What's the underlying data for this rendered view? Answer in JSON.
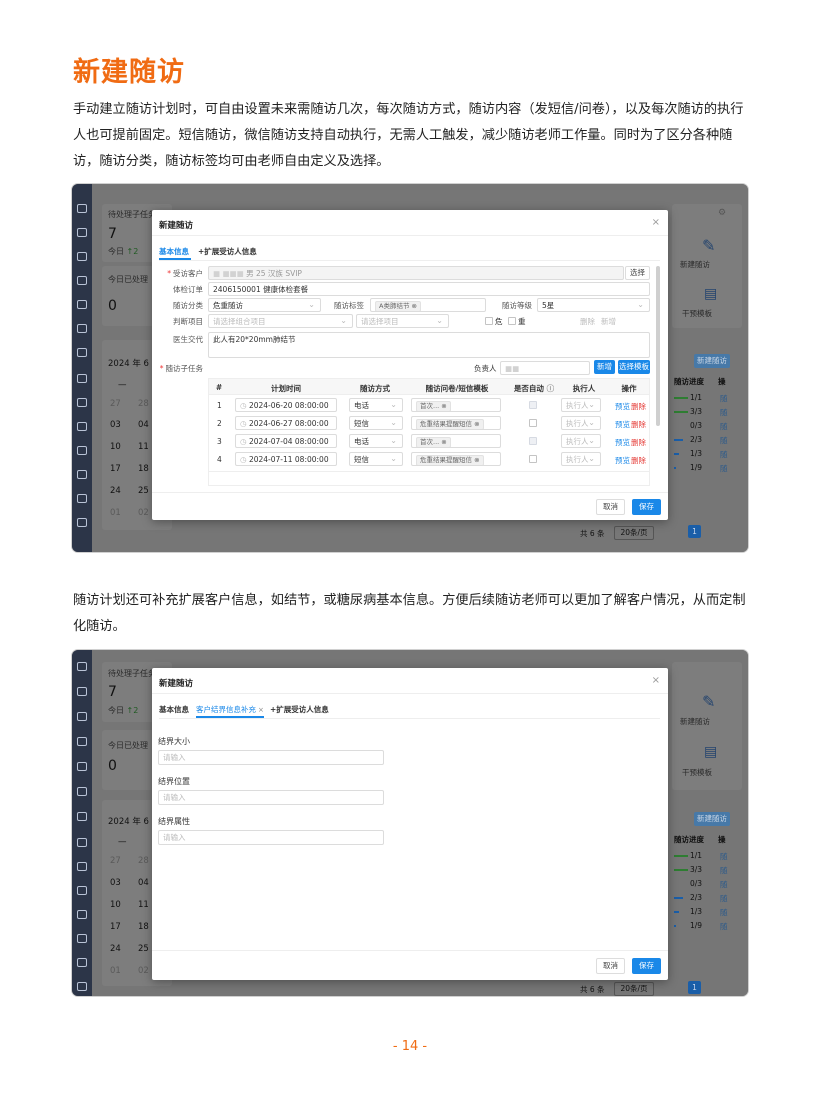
{
  "doc": {
    "heading": "新建随访",
    "para1": "手动建立随访计划时，可自由设置未来需随访几次，每次随访方式，随访内容（发短信/问卷），以及每次随访的执行人也可提前固定。短信随访，微信随访支持自动执行，无需人工触发，减少随访老师工作量。同时为了区分各种随访，随访分类，随访标签均可由老师自由定义及选择。",
    "para2": "随访计划还可补充扩展客户信息，如结节，或糖尿病基本信息。方便后续随访老师可以更加了解客户情况，从而定制化随访。",
    "page_number": "- 14 -"
  },
  "background": {
    "pending_label": "待处理子任务",
    "pending_count": "7",
    "today_label": "今日",
    "today_delta": "↑2",
    "processed_label": "今日已处理",
    "processed_count": "0",
    "calendar_title": "2024 年 6 月",
    "calendar_header": "—",
    "cal_rows": [
      [
        "27",
        "28"
      ],
      [
        "03",
        "04"
      ],
      [
        "10",
        "11"
      ],
      [
        "17",
        "18"
      ],
      [
        "24",
        "25"
      ],
      [
        "01",
        "02"
      ]
    ],
    "new_followup": "新建随访",
    "intervention": "干预模板",
    "new_btn": "新建随访",
    "col_progress": "随访进度",
    "col_op": "操",
    "progress_rows": [
      {
        "label": "1/1",
        "fill": 1.0,
        "color": "#2e7d32"
      },
      {
        "label": "3/3",
        "fill": 1.0,
        "color": "#2e7d32"
      },
      {
        "label": "0/3",
        "fill": 0.0,
        "color": "#2e7d32"
      },
      {
        "label": "2/3",
        "fill": 0.67,
        "color": "#1a5ea8"
      },
      {
        "label": "1/3",
        "fill": 0.33,
        "color": "#1a5ea8"
      },
      {
        "label": "1/9",
        "fill": 0.11,
        "color": "#1a5ea8"
      }
    ],
    "row_link": "随",
    "total": "共 6 条",
    "page_size": "20条/页",
    "page": "1"
  },
  "modal1": {
    "title": "新建随访",
    "tab_basic": "基本信息",
    "tab_extend": "+扩展受访人信息",
    "customer_label": "受访客户",
    "customer_value": "男 25 汉族 SVIP",
    "select_btn": "选择",
    "order_label": "体检订单",
    "order_value": "2406150001 健康体检套餐",
    "category_label": "随访分类",
    "category_value": "危重随访",
    "tag_label": "随访标签",
    "tag_value": "A类肺结节",
    "level_label": "随访等级",
    "level_value": "5星",
    "judge_label": "判断项目",
    "judge_ph1": "请选择组合项目",
    "judge_ph2": "请选择项目",
    "chk_danger": "危",
    "chk_severe": "重",
    "del_text": "删除",
    "add_text": "新增",
    "doctor_label": "医生交代",
    "doctor_value": "此人有20*20mm肺结节",
    "subtask_label": "随访子任务",
    "owner_label": "负责人",
    "add_btn": "新增",
    "template_btn": "选择模板",
    "columns": [
      "#",
      "计划时间",
      "随访方式",
      "随访问卷/短信模板",
      "是否自动",
      "执行人",
      "操作"
    ],
    "rows": [
      {
        "no": "1",
        "date": "2024-06-20 08:00:00",
        "method": "电话",
        "template": "首次...",
        "exec_ph": "执行人"
      },
      {
        "no": "2",
        "date": "2024-06-27 08:00:00",
        "method": "短信",
        "template": "危重结果提醒短信",
        "exec_ph": "执行人"
      },
      {
        "no": "3",
        "date": "2024-07-04 08:00:00",
        "method": "电话",
        "template": "首次...",
        "exec_ph": "执行人"
      },
      {
        "no": "4",
        "date": "2024-07-11 08:00:00",
        "method": "短信",
        "template": "危重结果提醒短信",
        "exec_ph": "执行人"
      }
    ],
    "preview": "预览",
    "delete": "删除",
    "cancel": "取消",
    "save": "保存"
  },
  "modal2": {
    "title": "新建随访",
    "tab_basic": "基本信息",
    "tab_nodule": "客户结界信息补充",
    "tab_extend": "+扩展受访人信息",
    "size_label": "结界大小",
    "pos_label": "结界位置",
    "attr_label": "结界属性",
    "input_ph": "请输入",
    "cancel": "取消",
    "save": "保存"
  },
  "colors": {
    "accent": "#f06b13",
    "primary": "#1a88e8",
    "danger": "#e53935"
  }
}
